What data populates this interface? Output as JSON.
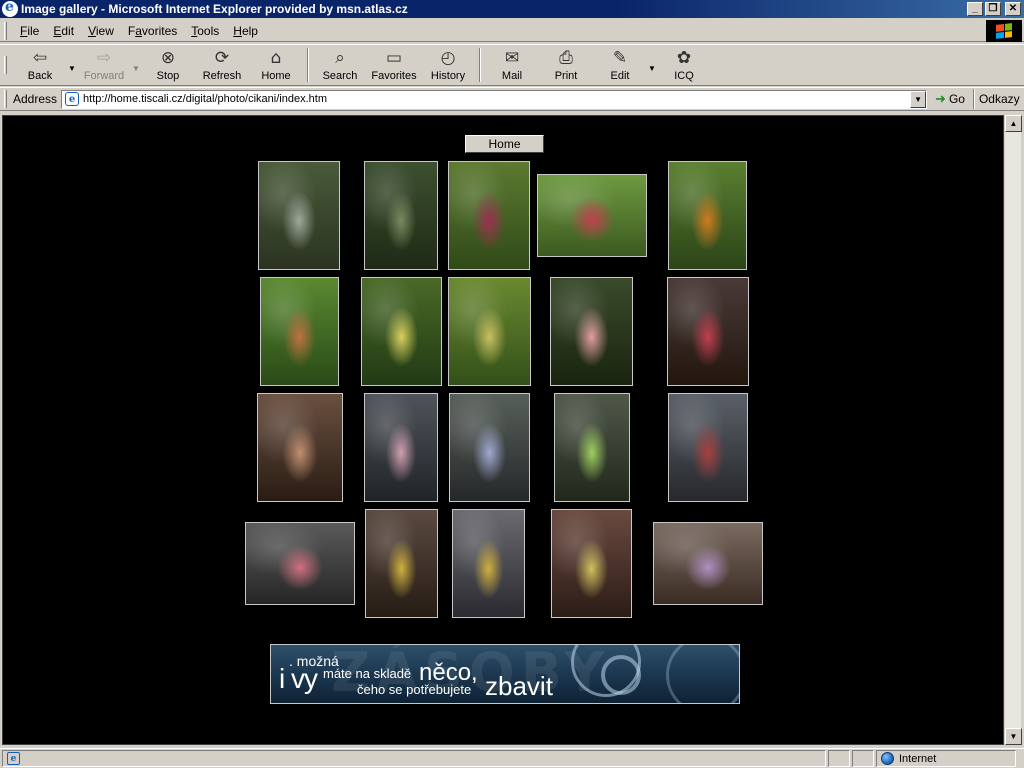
{
  "window": {
    "title": "Image gallery - Microsoft Internet Explorer provided by msn.atlas.cz",
    "minimize_label": "_",
    "restore_label": "❐",
    "close_label": "✕"
  },
  "menu": {
    "items": [
      {
        "label": "File",
        "accel": "F"
      },
      {
        "label": "Edit",
        "accel": "E"
      },
      {
        "label": "View",
        "accel": "V"
      },
      {
        "label": "Favorites",
        "accel": "a"
      },
      {
        "label": "Tools",
        "accel": "T"
      },
      {
        "label": "Help",
        "accel": "H"
      }
    ]
  },
  "toolbar": {
    "back": "Back",
    "forward": "Forward",
    "stop": "Stop",
    "refresh": "Refresh",
    "home": "Home",
    "search": "Search",
    "favorites": "Favorites",
    "history": "History",
    "mail": "Mail",
    "print": "Print",
    "edit": "Edit",
    "icq": "ICQ"
  },
  "address": {
    "label": "Address",
    "url": "http://home.tiscali.cz/digital/photo/cikani/index.htm",
    "go": "Go",
    "links": "Odkazy"
  },
  "page": {
    "home_button": "Home",
    "banner": {
      "line1": ". možná",
      "big": "i vy",
      "line2": "máte na skladě",
      "neco": "něco,",
      "line3": "čeho se potřebujete",
      "zbavit": "zbavit",
      "ghost_text": "ZÁSOBY"
    },
    "thumbnails": [
      {
        "name": "photo-park-path",
        "palette": [
          "#4a5a3a",
          "#a0a89a",
          "#2a3320"
        ]
      },
      {
        "name": "photo-tree-alley",
        "palette": [
          "#3d5030",
          "#7a8a60",
          "#1f2a16"
        ]
      },
      {
        "name": "photo-child-grass-1",
        "palette": [
          "#5c7a30",
          "#9a3050",
          "#304a18"
        ]
      },
      {
        "name": "photo-child-grass-2",
        "palette": [
          "#6e9a40",
          "#c04050",
          "#3c5a20"
        ]
      },
      {
        "name": "photo-two-kids-1",
        "palette": [
          "#5a8030",
          "#d07a20",
          "#2c4418"
        ]
      },
      {
        "name": "photo-two-kids-2",
        "palette": [
          "#5a8a30",
          "#c07040",
          "#2a4a18"
        ]
      },
      {
        "name": "photo-kids-field",
        "palette": [
          "#4a6a28",
          "#d8d060",
          "#223a14"
        ]
      },
      {
        "name": "photo-child-flowers",
        "palette": [
          "#6a8a30",
          "#c8c060",
          "#34501a"
        ]
      },
      {
        "name": "photo-girl-dress",
        "palette": [
          "#3a4a2a",
          "#e0a0a0",
          "#1a2410"
        ]
      },
      {
        "name": "photo-mother-child",
        "palette": [
          "#4a3a38",
          "#c04050",
          "#22160e"
        ]
      },
      {
        "name": "photo-girl-portrait",
        "palette": [
          "#6a5040",
          "#c09070",
          "#2a1c14"
        ]
      },
      {
        "name": "photo-girl-stroller",
        "palette": [
          "#50545a",
          "#d0a0b0",
          "#202428"
        ]
      },
      {
        "name": "photo-kids-street",
        "palette": [
          "#58605a",
          "#a0a8d0",
          "#24282a"
        ]
      },
      {
        "name": "photo-girls-playing",
        "palette": [
          "#50584a",
          "#a0d060",
          "#20281c"
        ]
      },
      {
        "name": "photo-car-street",
        "palette": [
          "#5a6068",
          "#a84040",
          "#26282c"
        ]
      },
      {
        "name": "photo-group-street",
        "palette": [
          "#5a5a5a",
          "#d07080",
          "#262626"
        ]
      },
      {
        "name": "photo-two-girls-1",
        "palette": [
          "#5a4a40",
          "#d0b040",
          "#261c14"
        ]
      },
      {
        "name": "photo-two-girls-2",
        "palette": [
          "#6a6a70",
          "#d0b040",
          "#2a2a30"
        ]
      },
      {
        "name": "photo-girls-building",
        "palette": [
          "#6a4a40",
          "#d0c060",
          "#2c1c16"
        ]
      },
      {
        "name": "photo-group-kids",
        "palette": [
          "#7a6a60",
          "#b090c0",
          "#3a2c24"
        ]
      }
    ]
  },
  "status": {
    "text": "",
    "zone": "Internet"
  }
}
